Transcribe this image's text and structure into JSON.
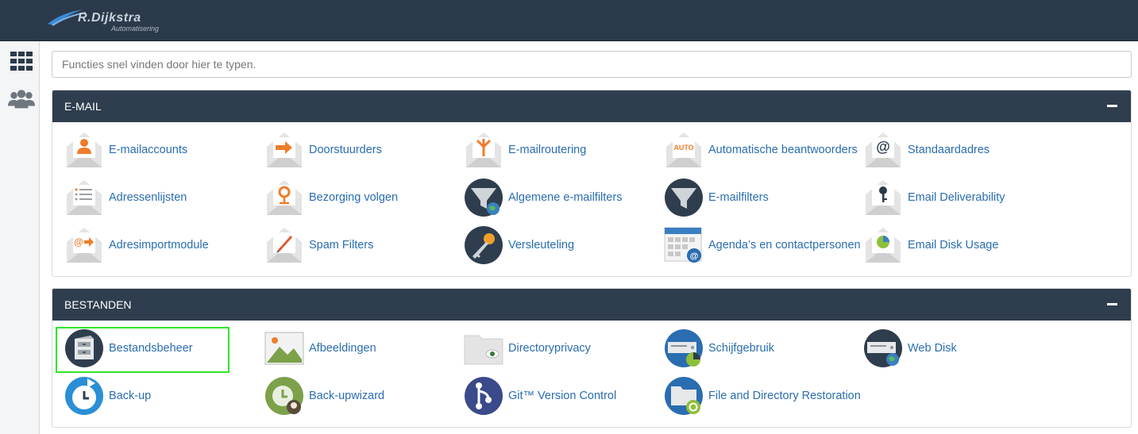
{
  "header": {
    "logo_name": "R.Dijkstra",
    "logo_tagline": "Automatisering"
  },
  "sidebar": {
    "items": [
      {
        "icon": "apps-grid-icon"
      },
      {
        "icon": "users-icon"
      }
    ]
  },
  "search": {
    "placeholder": "Functies snel vinden door hier te typen."
  },
  "sections": [
    {
      "title": "E-MAIL",
      "items": [
        {
          "label": "E-mailaccounts",
          "icon": "email-accounts-icon"
        },
        {
          "label": "Doorstuurders",
          "icon": "forwarders-icon"
        },
        {
          "label": "E-mailroutering",
          "icon": "email-routing-icon"
        },
        {
          "label": "Automatische beantwoorders",
          "icon": "autoresponders-icon"
        },
        {
          "label": "Standaardadres",
          "icon": "default-address-icon"
        },
        {
          "label": "Adressenlijsten",
          "icon": "mailing-lists-icon"
        },
        {
          "label": "Bezorging volgen",
          "icon": "track-delivery-icon"
        },
        {
          "label": "Algemene e-mailfilters",
          "icon": "global-email-filters-icon"
        },
        {
          "label": "E-mailfilters",
          "icon": "email-filters-icon"
        },
        {
          "label": "Email Deliverability",
          "icon": "email-deliverability-icon"
        },
        {
          "label": "Adresimportmodule",
          "icon": "address-importer-icon"
        },
        {
          "label": "Spam Filters",
          "icon": "spam-filters-icon"
        },
        {
          "label": "Versleuteling",
          "icon": "encryption-icon"
        },
        {
          "label": "Agenda’s en contactpersonen",
          "icon": "calendars-contacts-icon"
        },
        {
          "label": "Email Disk Usage",
          "icon": "email-disk-usage-icon"
        }
      ]
    },
    {
      "title": "BESTANDEN",
      "items": [
        {
          "label": "Bestandsbeheer",
          "icon": "file-manager-icon"
        },
        {
          "label": "Afbeeldingen",
          "icon": "images-icon"
        },
        {
          "label": "Directoryprivacy",
          "icon": "directory-privacy-icon"
        },
        {
          "label": "Schijfgebruik",
          "icon": "disk-usage-icon"
        },
        {
          "label": "Web Disk",
          "icon": "web-disk-icon"
        },
        {
          "label": "Back-up",
          "icon": "backup-icon"
        },
        {
          "label": "Back-upwizard",
          "icon": "backup-wizard-icon"
        },
        {
          "label": "Git™ Version Control",
          "icon": "git-version-control-icon"
        },
        {
          "label": "File and Directory Restoration",
          "icon": "file-restoration-icon"
        }
      ]
    }
  ],
  "colors": {
    "accent_link": "#2a6db0",
    "header_bg": "#2b3a4a",
    "panel_header_bg": "#2f3e4e",
    "highlight": "#2ee82a",
    "orange": "#f07c2a"
  }
}
